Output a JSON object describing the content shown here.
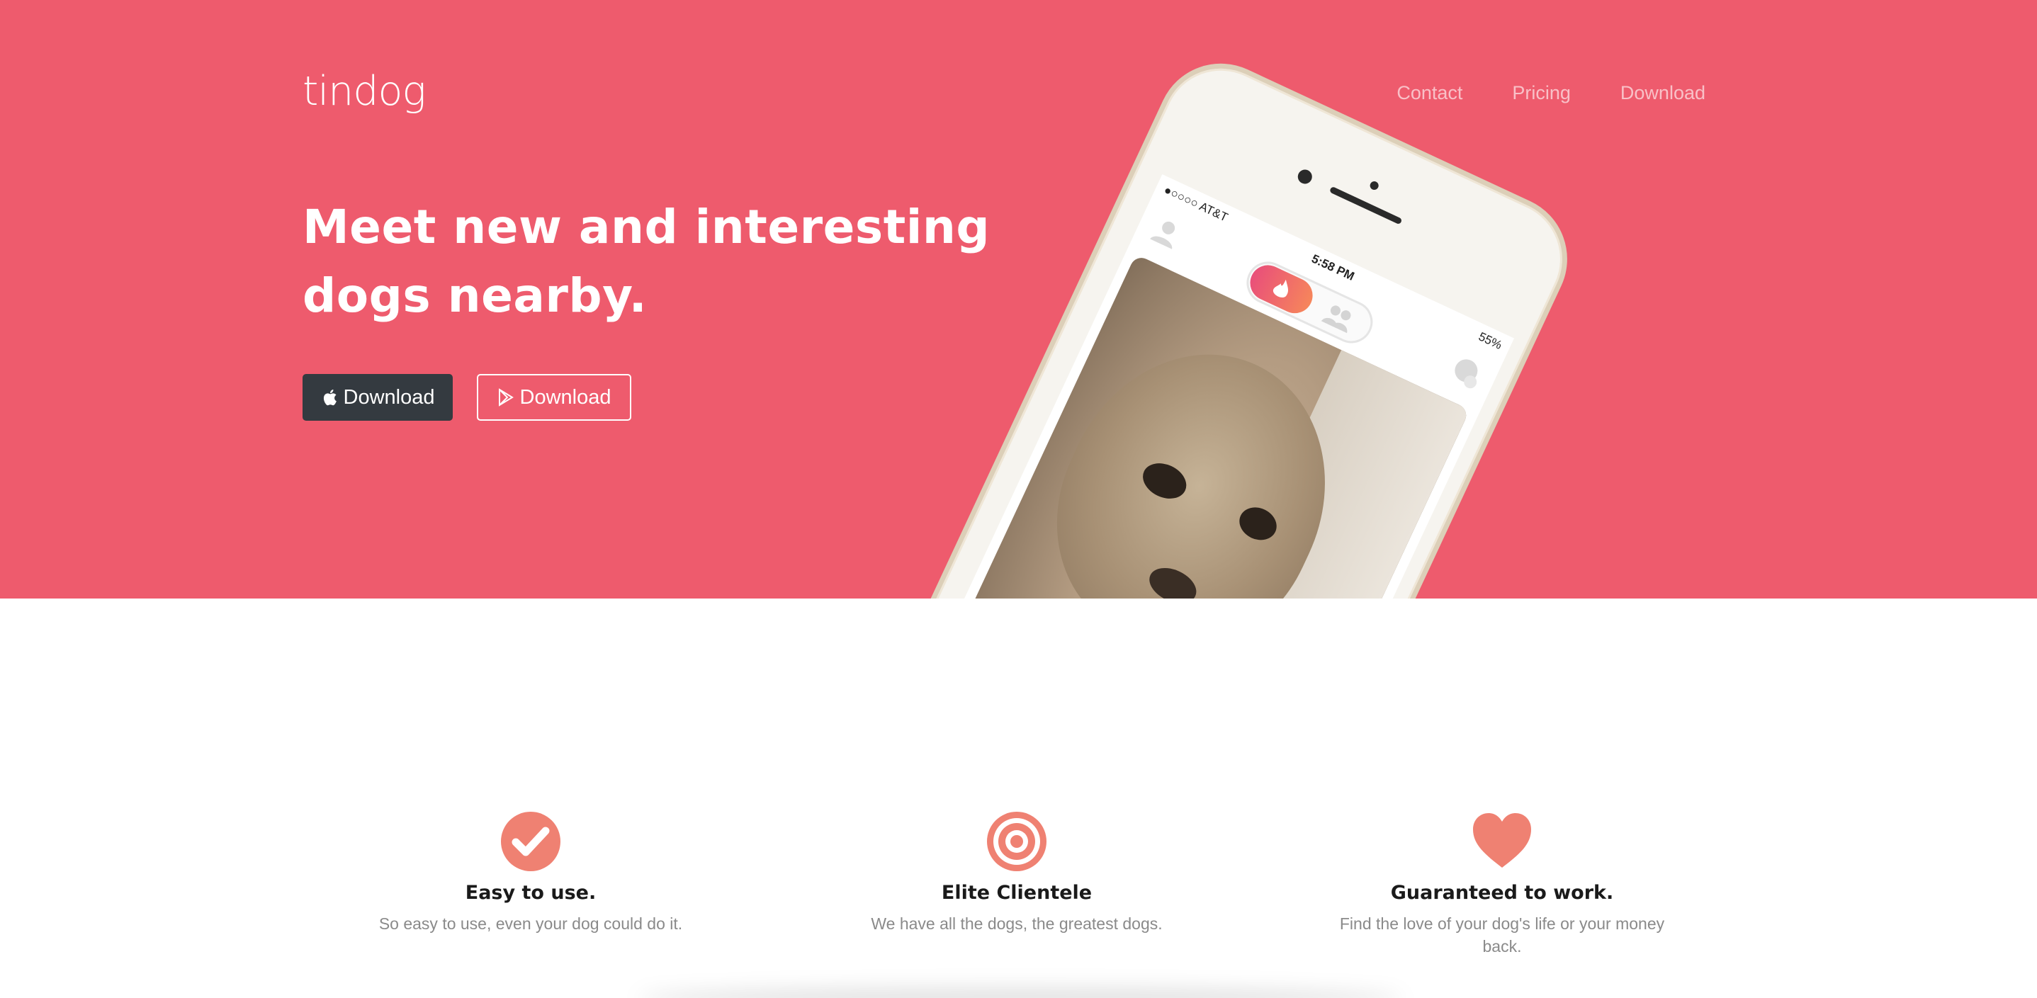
{
  "brand": {
    "logo": "tindog"
  },
  "nav": {
    "items": [
      "Contact",
      "Pricing",
      "Download"
    ]
  },
  "hero": {
    "headline": "Meet new and interesting dogs nearby.",
    "buttons": {
      "apple_label": "Download",
      "play_label": "Download"
    }
  },
  "phone": {
    "carrier": "●○○○○ AT&T",
    "time": "5:58 PM",
    "battery": "55%"
  },
  "features": [
    {
      "icon": "check-circle-icon",
      "title": "Easy to use.",
      "text": "So easy to use, even your dog could do it."
    },
    {
      "icon": "target-icon",
      "title": "Elite Clientele",
      "text": "We have all the dogs, the greatest dogs."
    },
    {
      "icon": "heart-icon",
      "title": "Guaranteed to work.",
      "text": "Find the love of your dog's life or your money back."
    }
  ],
  "colors": {
    "hero_bg": "#ee5b6d",
    "dark_button": "#343a40",
    "icon": "#ef8172",
    "title": "#1a1a1a",
    "muted": "#8a8a8a"
  }
}
